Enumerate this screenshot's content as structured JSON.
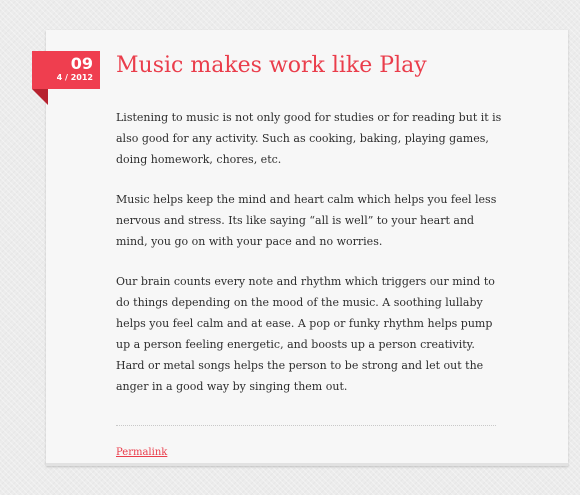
{
  "post": {
    "date": {
      "day": "09",
      "month_year": "4 / 2012"
    },
    "title": "Music makes work like Play",
    "paragraphs": [
      "Listening to music is not only good for studies or for reading but it is also good for any activity. Such as cooking, baking, playing games, doing homework, chores, etc.",
      "Music helps keep the mind and heart calm which helps you feel less nervous and stress. Its like saying “all is well” to your heart and mind, you go on with your pace and no worries.",
      "Our brain counts every note and rhythm which triggers our mind to do things depending on the mood of the music. A soothing lullaby helps you feel calm and at ease. A pop or funky rhythm helps pump up a person feeling energetic, and boosts up a person creativity. Hard or metal songs helps the person to be strong and let out the anger in a good way by singing them out."
    ],
    "permalink_label": "Permalink"
  },
  "colors": {
    "accent": "#ef3e4f",
    "accent_dark": "#b7222f",
    "card_background": "#f7f7f7",
    "page_background": "#ececec",
    "body_text": "#2d2d2d"
  }
}
